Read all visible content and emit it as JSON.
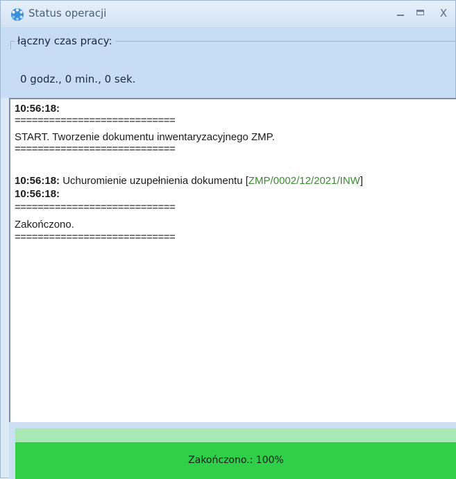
{
  "window": {
    "title": "Status operacji",
    "minimize_glyph": "_",
    "maximize_glyph": "□",
    "close_glyph": "X",
    "icon": "spinner-icon"
  },
  "worktime": {
    "label": "łączny czas pracy:",
    "value": "0 godz., 0 min., 0 sek."
  },
  "log": {
    "line1_time": "10:56:18:",
    "sep": "============================",
    "start_text": "START. Tworzenie dokumentu inwentaryzacyjnego ZMP.",
    "line2_time": "10:56:18:",
    "line2_text": " Uchuromienie uzupełnienia dokumentu [",
    "line2_doc": "ZMP/0002/12/2021/INW",
    "line2_close": "]",
    "line3_time": "10:56:18:",
    "done_text": "Zakończono."
  },
  "progress": {
    "label": "Zakończono.: 100%",
    "value": 100
  },
  "colors": {
    "progress_fill": "#2fcf4a",
    "progress_track": "#a8e8b5",
    "doc_link": "#3a8a2e",
    "panel_bg": "#c7ddf5"
  }
}
